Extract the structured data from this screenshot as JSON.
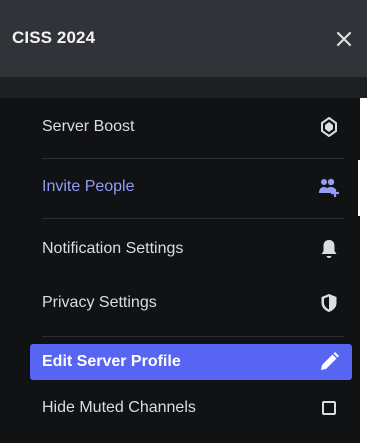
{
  "header": {
    "title": "CISS 2024",
    "close_icon": "close-icon"
  },
  "menu": {
    "items": [
      {
        "label": "Server Boost",
        "icon": "server-boost-icon"
      },
      {
        "label": "Invite People",
        "icon": "add-person-icon"
      },
      {
        "label": "Notification Settings",
        "icon": "bell-icon"
      },
      {
        "label": "Privacy Settings",
        "icon": "shield-icon"
      },
      {
        "label": "Edit Server Profile",
        "icon": "pencil-icon",
        "active": true
      },
      {
        "label": "Hide Muted Channels",
        "icon": "checkbox-icon",
        "checked": false
      }
    ]
  },
  "colors": {
    "accent": "#5865f2",
    "invite_text": "#949cf7",
    "menu_bg": "#111214",
    "header_bg": "#313338",
    "text": "#dbdee1"
  }
}
